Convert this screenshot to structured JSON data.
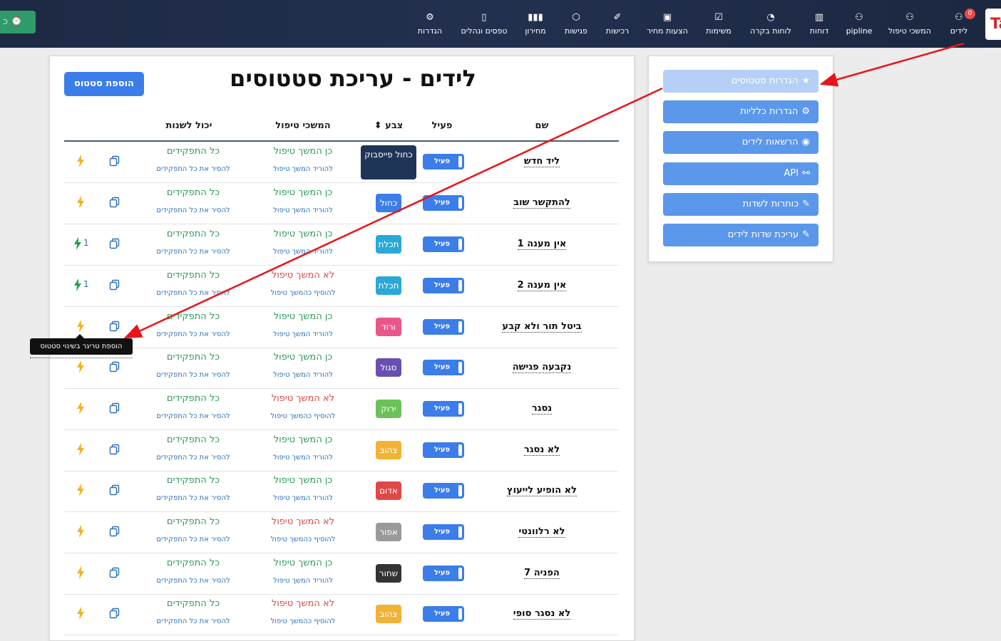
{
  "colors": {
    "nav_bg": "#1e2a44",
    "accent_blue": "#3b7de9",
    "side_button": "#5b97ea",
    "side_button_active": "#b5cff6",
    "green_text": "#2c9b55",
    "red_text": "#e04848",
    "link_blue": "#2a6fb8",
    "arrow_red": "#e8141a"
  },
  "topbar": {
    "left_pill": "כ ⌚",
    "logo": "Ta",
    "items": [
      {
        "label": "לידים",
        "icon": "user-icon",
        "glyph": "⚇",
        "badge": "0"
      },
      {
        "label": "המשכי טיפול",
        "icon": "user-icon",
        "glyph": "⚇"
      },
      {
        "label": "pipline",
        "icon": "user-icon",
        "glyph": "⚇"
      },
      {
        "label": "דוחות",
        "icon": "bar-chart-icon",
        "glyph": "▥"
      },
      {
        "label": "לוחות בקרה",
        "icon": "dashboard-icon",
        "glyph": "◔"
      },
      {
        "label": "משימות",
        "icon": "checkbox-icon",
        "glyph": "☑"
      },
      {
        "label": "הצעות מחיר",
        "icon": "quote-icon",
        "glyph": "▣"
      },
      {
        "label": "רכישות",
        "icon": "purchase-icon",
        "glyph": "✐"
      },
      {
        "label": "פגישות",
        "icon": "handshake-icon",
        "glyph": "⬡"
      },
      {
        "label": "מחירון",
        "icon": "barcode-icon",
        "glyph": "▮▮▮"
      },
      {
        "label": "טפסים ונהלים",
        "icon": "document-icon",
        "glyph": "▯"
      },
      {
        "label": "הגדרות",
        "icon": "gear-icon",
        "glyph": "⚙"
      }
    ]
  },
  "main": {
    "title": "לידים - עריכת סטטוסים",
    "add_button": "הוספת סטטוס",
    "columns": {
      "name": "שם",
      "active": "פעיל",
      "color": "צבע",
      "sort_glyph": "⬍",
      "handling": "המשכי טיפול",
      "roles": "יכול לשנות"
    },
    "rows": [
      {
        "name": "ליד חדש",
        "active": "פעיל",
        "color_label": "כחול פייסבוק",
        "color_hex": "#1f3558",
        "handling": "כן המשך טיפול",
        "handling_yes": true,
        "handling_action": "להוריד המשך טיפול",
        "roles": "כל התפקידים",
        "roles_action": "להסיר את כל התפקידים",
        "trigger_count": "",
        "bolt_color": "#f0b429"
      },
      {
        "name": "להתקשר שוב",
        "active": "פעיל",
        "color_label": "כחול",
        "color_hex": "#3b7de9",
        "handling": "כן המשך טיפול",
        "handling_yes": true,
        "handling_action": "להוריד המשך טיפול",
        "roles": "כל התפקידים",
        "roles_action": "להסיר את כל התפקידים",
        "trigger_count": "",
        "bolt_color": "#f0b429"
      },
      {
        "name": "אין מענה 1",
        "active": "פעיל",
        "color_label": "תכלת",
        "color_hex": "#2aa8d8",
        "handling": "כן המשך טיפול",
        "handling_yes": true,
        "handling_action": "להוריד המשך טיפול",
        "roles": "כל התפקידים",
        "roles_action": "להסיר את כל התפקידים",
        "trigger_count": "1",
        "bolt_color": "#2c9b55"
      },
      {
        "name": "אין מענה 2",
        "active": "פעיל",
        "color_label": "תכלת",
        "color_hex": "#2aa8d8",
        "handling": "לא המשך טיפול",
        "handling_yes": false,
        "handling_action": "להוסיף כהמשך טיפול",
        "roles": "כל התפקידים",
        "roles_action": "להסיר את כל התפקידים",
        "trigger_count": "1",
        "bolt_color": "#2c9b55"
      },
      {
        "name": "ביטל תור ולא קבע",
        "active": "פעיל",
        "color_label": "ורוד",
        "color_hex": "#e9568a",
        "handling": "כן המשך טיפול",
        "handling_yes": true,
        "handling_action": "להוריד המשך טיפול",
        "roles": "כל התפקידים",
        "roles_action": "להסיר את כל התפקידים",
        "trigger_count": "",
        "bolt_color": "#f0b429"
      },
      {
        "name": "נקבעה פגישה",
        "active": "פעיל",
        "color_label": "סגול",
        "color_hex": "#6a4fb0",
        "handling": "כן המשך טיפול",
        "handling_yes": true,
        "handling_action": "להוריד המשך טיפול",
        "roles": "כל התפקידים",
        "roles_action": "להסיר את כל התפקידים",
        "trigger_count": "",
        "bolt_color": "#f0b429"
      },
      {
        "name": "נסגר",
        "active": "פעיל",
        "color_label": "ירוק",
        "color_hex": "#6cc25a",
        "handling": "לא המשך טיפול",
        "handling_yes": false,
        "handling_action": "להוסיף כהמשך טיפול",
        "roles": "כל התפקידים",
        "roles_action": "להסיר את כל התפקידים",
        "trigger_count": "",
        "bolt_color": "#f0b429"
      },
      {
        "name": "לא נסגר",
        "active": "פעיל",
        "color_label": "צהוב",
        "color_hex": "#f2b233",
        "handling": "כן המשך טיפול",
        "handling_yes": true,
        "handling_action": "להוריד המשך טיפול",
        "roles": "כל התפקידים",
        "roles_action": "להסיר את כל התפקידים",
        "trigger_count": "",
        "bolt_color": "#f0b429"
      },
      {
        "name": "לא הופיע לייעוץ",
        "active": "פעיל",
        "color_label": "אדום",
        "color_hex": "#e04848",
        "handling": "כן המשך טיפול",
        "handling_yes": true,
        "handling_action": "להוריד המשך טיפול",
        "roles": "כל התפקידים",
        "roles_action": "להסיר את כל התפקידים",
        "trigger_count": "",
        "bolt_color": "#f0b429"
      },
      {
        "name": "לא רלוונטי",
        "active": "פעיל",
        "color_label": "אפור",
        "color_hex": "#9a9a9a",
        "handling": "לא המשך טיפול",
        "handling_yes": false,
        "handling_action": "להוסיף כהמשך טיפול",
        "roles": "כל התפקידים",
        "roles_action": "להסיר את כל התפקידים",
        "trigger_count": "",
        "bolt_color": "#f0b429"
      },
      {
        "name": "הפניה 7",
        "active": "פעיל",
        "color_label": "שחור",
        "color_hex": "#333333",
        "handling": "כן המשך טיפול",
        "handling_yes": true,
        "handling_action": "להוריד המשך טיפול",
        "roles": "כל התפקידים",
        "roles_action": "להסיר את כל התפקידים",
        "trigger_count": "",
        "bolt_color": "#f0b429"
      },
      {
        "name": "לא נסגר סופי",
        "active": "פעיל",
        "color_label": "צהוב",
        "color_hex": "#f2b233",
        "handling": "לא המשך טיפול",
        "handling_yes": false,
        "handling_action": "להוסיף כהמשך טיפול",
        "roles": "כל התפקידים",
        "roles_action": "להסיר את כל התפקידים",
        "trigger_count": "",
        "bolt_color": "#f0b429"
      }
    ]
  },
  "side": {
    "buttons": [
      {
        "label": "הגדרות סטטוסים",
        "icon": "star-icon",
        "glyph": "★",
        "active": true
      },
      {
        "label": "הגדרות כלליות",
        "icon": "gear-icon",
        "glyph": "⚙",
        "active": false
      },
      {
        "label": "הרשאות לידים",
        "icon": "eye-slash-icon",
        "glyph": "◉",
        "active": false
      },
      {
        "label": "API",
        "icon": "link-icon",
        "glyph": "⚯",
        "active": false
      },
      {
        "label": "כותרות לשדות",
        "icon": "edit-icon",
        "glyph": "✎",
        "active": false
      },
      {
        "label": "עריכת שדות לידים",
        "icon": "edit-icon",
        "glyph": "✎",
        "active": false
      }
    ]
  },
  "tooltip": {
    "text": "הוספת טריגר בשינוי סטטוס"
  }
}
